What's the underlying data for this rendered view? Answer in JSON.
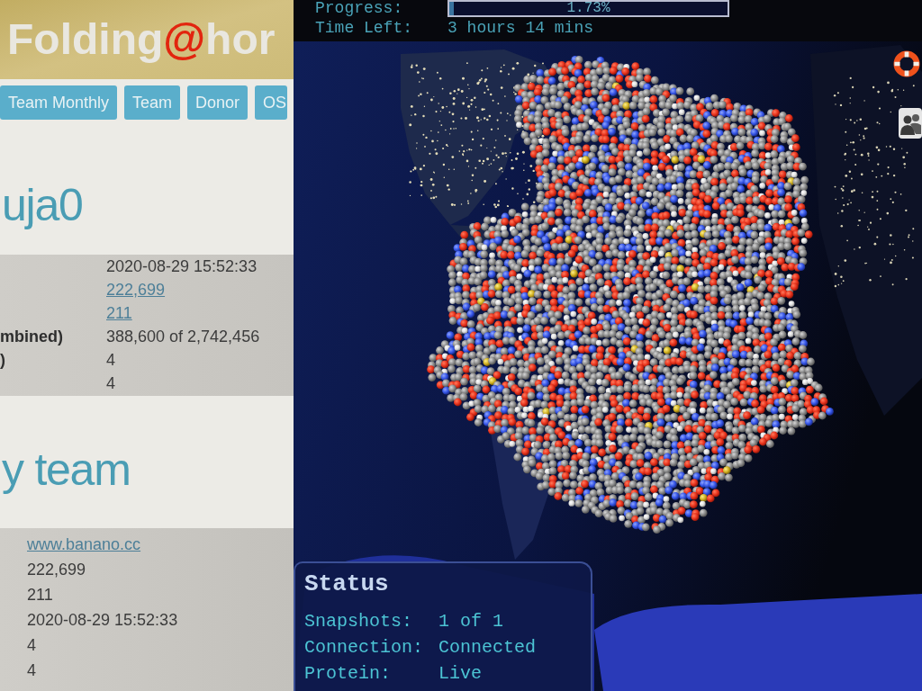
{
  "webpage": {
    "logo": {
      "text": "Folding",
      "accent": "@",
      "rest": "hor"
    },
    "tabs": [
      {
        "label": "Team Monthly",
        "selected": false
      },
      {
        "label": "Team",
        "selected": false
      },
      {
        "label": "Donor",
        "selected": false
      },
      {
        "label": "OS",
        "selected": false
      }
    ],
    "donor_section": {
      "heading": "uja0",
      "rows": [
        {
          "value": "2020-08-29 15:52:33",
          "kind": "text"
        },
        {
          "value": "222,699",
          "kind": "link"
        },
        {
          "value": "211",
          "kind": "link"
        },
        {
          "label": "mbined)",
          "value": "388,600 of 2,742,456",
          "kind": "text"
        },
        {
          "label": ")",
          "value": "4",
          "kind": "text"
        },
        {
          "value": "4",
          "kind": "text"
        }
      ]
    },
    "team_section": {
      "heading": "y team",
      "rows": [
        {
          "value": "www.banano.cc",
          "kind": "link"
        },
        {
          "value": "222,699",
          "kind": "text"
        },
        {
          "value": "211",
          "kind": "text"
        },
        {
          "value": "2020-08-29 15:52:33",
          "kind": "text"
        },
        {
          "value": "4",
          "kind": "text"
        },
        {
          "value": "4",
          "kind": "text"
        }
      ]
    }
  },
  "viewer": {
    "progress": {
      "label": "Progress:",
      "level": 0.0173,
      "reading": "1.73%"
    },
    "time_left": {
      "label": "Time Left:",
      "value": "3 hours 14 mins"
    },
    "status": {
      "title": "Status",
      "rows": [
        {
          "label": "Snapshots:",
          "value": "1 of 1"
        },
        {
          "label": "Connection:",
          "value": "Connected"
        },
        {
          "label": "Protein:",
          "value": "Live"
        }
      ]
    }
  }
}
